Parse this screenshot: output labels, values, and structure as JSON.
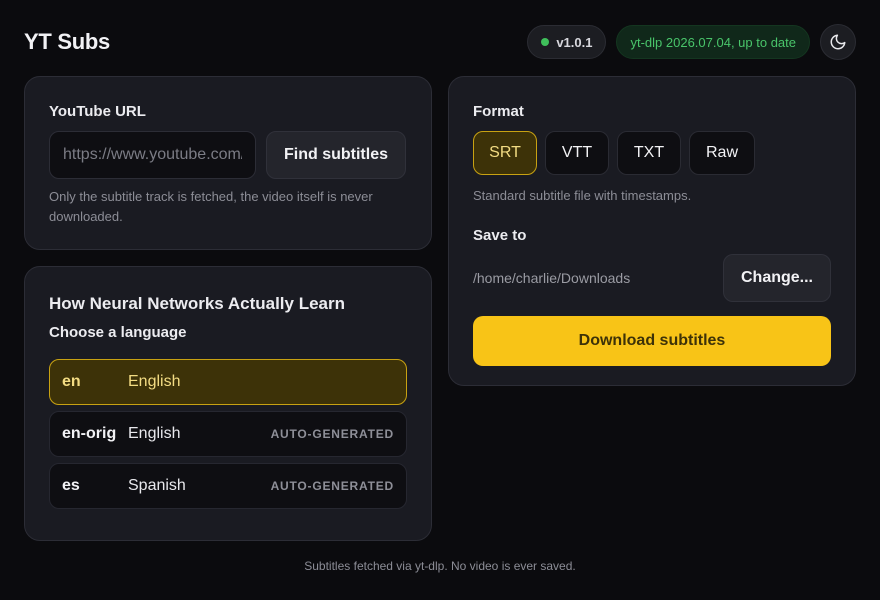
{
  "header": {
    "title": "YT Subs",
    "version": "v1.0.1",
    "ytdlp_status": "yt-dlp 2026.07.04, up to date",
    "theme_icon": "moon-icon"
  },
  "url_card": {
    "label": "YouTube URL",
    "input_value": "",
    "input_placeholder": "https://www.youtube.com/watch?v=",
    "find_button": "Find subtitles",
    "hint": "Only the subtitle track is fetched, the video itself is never downloaded."
  },
  "language_card": {
    "video_title": "How Neural Networks Actually Learn",
    "choose_label": "Choose a language",
    "languages": [
      {
        "code": "en",
        "name": "English",
        "badge": "",
        "selected": true
      },
      {
        "code": "en-orig",
        "name": "English",
        "badge": "AUTO-GENERATED",
        "selected": false
      },
      {
        "code": "es",
        "name": "Spanish",
        "badge": "AUTO-GENERATED",
        "selected": false
      }
    ]
  },
  "format_card": {
    "label": "Format",
    "formats": [
      "SRT",
      "VTT",
      "TXT",
      "Raw"
    ],
    "selected_format": "SRT",
    "format_hint": "Standard subtitle file with timestamps.",
    "save_label": "Save to",
    "save_path": "/home/charlie/Downloads",
    "change_button": "Change...",
    "download_button": "Download subtitles"
  },
  "footer": {
    "text": "Subtitles fetched via yt-dlp. No video is ever saved."
  },
  "colors": {
    "accent": "#f8c417",
    "status_green": "#3fbf5b",
    "background": "#0b0b0e",
    "card": "#1a1b22"
  }
}
